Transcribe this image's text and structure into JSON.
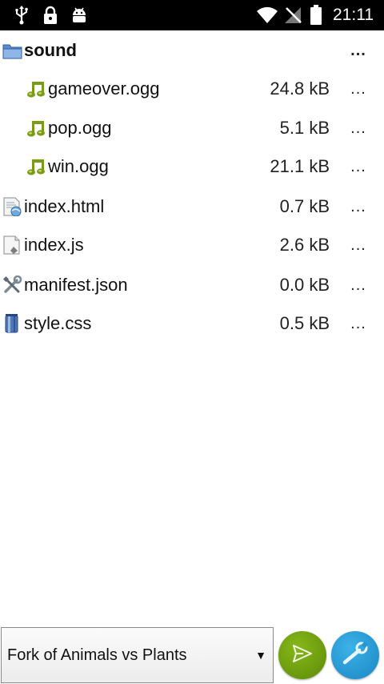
{
  "status_bar": {
    "time": "21:11",
    "left_icons": [
      "usb-icon",
      "lock-icon",
      "android-icon"
    ],
    "right_icons": [
      "wifi-icon",
      "no-signal-icon",
      "battery-icon"
    ]
  },
  "files": [
    {
      "kind": "folder",
      "icon": "folder-icon",
      "name": "sound",
      "size": "",
      "menu": "...",
      "indent": 0
    },
    {
      "kind": "audio",
      "icon": "music-note-icon",
      "name": "gameover.ogg",
      "size": "24.8 kB",
      "menu": "...",
      "indent": 1
    },
    {
      "kind": "audio",
      "icon": "music-note-icon",
      "name": "pop.ogg",
      "size": "5.1 kB",
      "menu": "...",
      "indent": 1
    },
    {
      "kind": "audio",
      "icon": "music-note-icon",
      "name": "win.ogg",
      "size": "21.1 kB",
      "menu": "...",
      "indent": 1
    },
    {
      "kind": "html",
      "icon": "html-file-icon",
      "name": "index.html",
      "size": "0.7 kB",
      "menu": "...",
      "indent": 0
    },
    {
      "kind": "js",
      "icon": "script-file-icon",
      "name": "index.js",
      "size": "2.6 kB",
      "menu": "...",
      "indent": 0
    },
    {
      "kind": "json",
      "icon": "tools-icon",
      "name": "manifest.json",
      "size": "0.0 kB",
      "menu": "...",
      "indent": 0
    },
    {
      "kind": "css",
      "icon": "css-file-icon",
      "name": "style.css",
      "size": "0.5 kB",
      "menu": "...",
      "indent": 0
    }
  ],
  "bottom_bar": {
    "project_name": "Fork of Animals vs Plants",
    "dropdown_caret": "▼",
    "send_button_icon": "send-icon",
    "tools_button_icon": "wrench-icon"
  },
  "colors": {
    "status_bar_bg": "#000000",
    "send_button": "#6f9d0d",
    "tools_button": "#2596d4",
    "music_icon": "#7a9a1a"
  }
}
